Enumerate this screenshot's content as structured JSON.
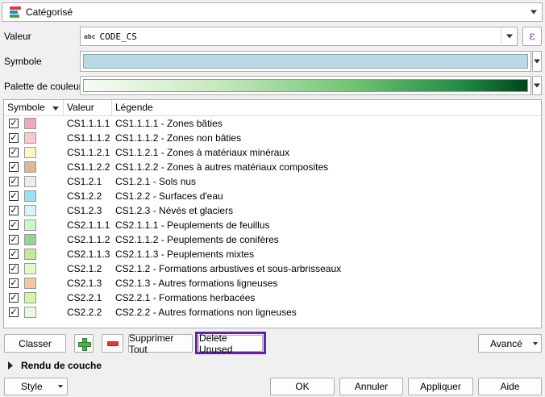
{
  "renderer": {
    "label": "Catégorisé"
  },
  "valeur": {
    "label": "Valeur",
    "type_badge": "abc",
    "value": "CODE_CS",
    "expression_glyph": "ε"
  },
  "symbole": {
    "label": "Symbole",
    "color": "#b9d9e6"
  },
  "palette": {
    "label": "Palette de couleur"
  },
  "table": {
    "headers": {
      "symbole": "Symbole",
      "valeur": "Valeur",
      "legende": "Légende"
    },
    "rows": [
      {
        "checked": "✓",
        "color": "#f4a6c0",
        "value": "CS1.1.1.1",
        "legend": "CS1.1.1.1 - Zones bâties"
      },
      {
        "checked": "✓",
        "color": "#f8c9cf",
        "value": "CS1.1.1.2",
        "legend": "CS1.1.1.2 - Zones non bâties"
      },
      {
        "checked": "✓",
        "color": "#fcf6c4",
        "value": "CS1.1.2.1",
        "legend": "CS1.1.2.1 - Zones à matériaux minéraux"
      },
      {
        "checked": "✓",
        "color": "#dcb896",
        "value": "CS1.1.2.2",
        "legend": "CS1.1.2.2 - Zones à autres matériaux composites"
      },
      {
        "checked": "✓",
        "color": "#ececec",
        "value": "CS1.2.1",
        "legend": "CS1.2.1 - Sols nus"
      },
      {
        "checked": "✓",
        "color": "#9be0f6",
        "value": "CS1.2.2",
        "legend": "CS1.2.2 - Surfaces d'eau"
      },
      {
        "checked": "✓",
        "color": "#d8f4f6",
        "value": "CS1.2.3",
        "legend": "CS1.2.3 - Névés et glaciers"
      },
      {
        "checked": "✓",
        "color": "#c8f6c9",
        "value": "CS2.1.1.1",
        "legend": "CS2.1.1.1 - Peuplements de feuillus"
      },
      {
        "checked": "✓",
        "color": "#96d48c",
        "value": "CS2.1.1.2",
        "legend": "CS2.1.1.2 - Peuplements de conifères"
      },
      {
        "checked": "✓",
        "color": "#c2e898",
        "value": "CS2.1.1.3",
        "legend": "CS2.1.1.3 - Peuplements mixtes"
      },
      {
        "checked": "✓",
        "color": "#e3f8c4",
        "value": "CS2.1.2",
        "legend": "CS2.1.2 - Formations arbustives et sous-arbrisseaux"
      },
      {
        "checked": "✓",
        "color": "#f6c79a",
        "value": "CS2.1.3",
        "legend": "CS2.1.3 - Autres formations ligneuses"
      },
      {
        "checked": "✓",
        "color": "#d6f6a6",
        "value": "CS2.2.1",
        "legend": "CS2.2.1 - Formations herbacées"
      },
      {
        "checked": "✓",
        "color": "#e8fae0",
        "value": "CS2.2.2",
        "legend": "CS2.2.2 - Autres formations non ligneuses"
      }
    ]
  },
  "buttons": {
    "classer": "Classer",
    "supprimer_tout": "Supprimer Tout",
    "delete_unused": "Delete Unused",
    "avance": "Avancé"
  },
  "rendu": {
    "label": "Rendu de couche"
  },
  "footer": {
    "style": "Style",
    "ok": "OK",
    "annuler": "Annuler",
    "appliquer": "Appliquer",
    "aide": "Aide"
  },
  "colors": {
    "highlight": "#6a1fb0",
    "ramp_start": "#f7fcf5",
    "ramp_end": "#00441b"
  }
}
